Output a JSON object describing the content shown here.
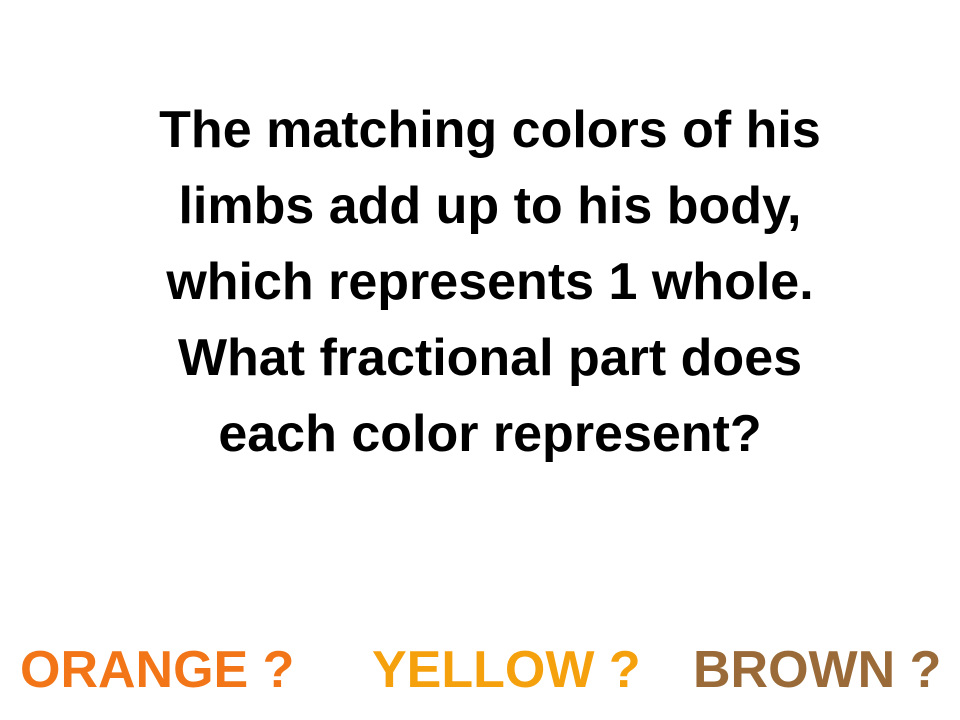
{
  "slide": {
    "question_lines": [
      "The matching colors of his",
      "limbs add up to his body,",
      "which represents 1 whole.",
      "What fractional part does",
      "each color represent?"
    ],
    "colors": [
      {
        "label": "ORANGE ?",
        "color": "#f27518"
      },
      {
        "label": "YELLOW ?",
        "color": "#f5a10e"
      },
      {
        "label": "BROWN ?",
        "color": "#9a6b38"
      }
    ],
    "text_color": "#000000",
    "background": "#ffffff"
  }
}
